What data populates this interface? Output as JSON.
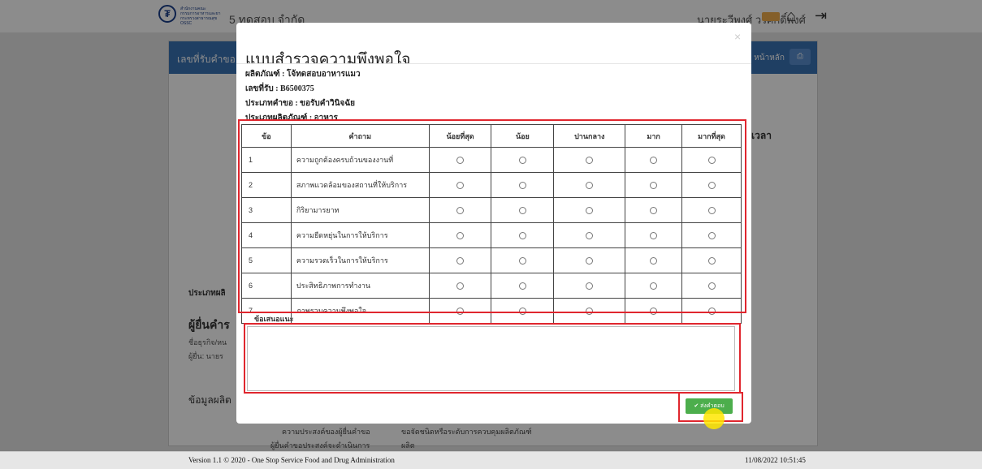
{
  "header": {
    "logo_text": "สำนักงานคณะกรรมการอาหารและยา กระทรวงสาธารณสุข OSSC",
    "title": "5 ทดสอบ จำกัด",
    "user": "นายระวีพงศ์ วรศักดิ์พงศ์"
  },
  "panel": {
    "header_left": "เลขที่รับคำขอ",
    "header_right": "หน้าหลัก",
    "time_label": "เวลา",
    "product_type_label": "ประเภทผลิ",
    "applicant_heading": "ผู้ยื่นคำร",
    "business_label": "ชื่อธุรกิจ/หน",
    "applicant_label": "ผู้ยื่น: นายร",
    "product_info_heading": "ข้อมูลผลิต",
    "purpose_label": "ความประสงค์ของผู้ยื่นคำขอ",
    "purpose_value": "ขอจัดชนิดหรือระดับการควบคุมผลิตภัณฑ์",
    "operation_label": "ผู้ยื่นคำขอประสงค์จะดำเนินการ",
    "operation_value": "ผลิต"
  },
  "modal": {
    "title": "แบบสำรวจความพึงพอใจ",
    "close": "×",
    "info": [
      "ผลิตภัณฑ์ : โจ้ทดสอบอาหารแมว",
      "เลขที่รับ : B6500375",
      "ประเภทคำขอ : ขอรับคำวินิจฉัย",
      "ประเภทผลิตภัณฑ์ : อาหาร"
    ],
    "table": {
      "headers": [
        "ข้อ",
        "คำถาม",
        "น้อยที่สุด",
        "น้อย",
        "ปานกลาง",
        "มาก",
        "มากที่สุด"
      ],
      "rows": [
        {
          "no": "1",
          "question": "ความถูกต้องครบถ้วนของงานที่"
        },
        {
          "no": "2",
          "question": "สภาพแวดล้อมของสถานที่ให้บริการ"
        },
        {
          "no": "3",
          "question": "กิริยามารยาท"
        },
        {
          "no": "4",
          "question": "ความยืดหยุ่นในการให้บริการ"
        },
        {
          "no": "5",
          "question": "ความรวดเร็วในการให้บริการ"
        },
        {
          "no": "6",
          "question": "ประสิทธิภาพการทำงาน"
        },
        {
          "no": "7",
          "question": "ภาพรวมความพึงพอใจ"
        }
      ]
    },
    "suggestion_label": "ข้อเสนอแนะ",
    "suggestion_value": "",
    "submit_label": "✔ ส่งคำตอบ"
  },
  "footer": {
    "version": "Version 1.1 © 2020 - One Stop Service Food and Drug Administration",
    "datetime": "11/08/2022 10:51:45"
  },
  "colors": {
    "highlight": "#e0262e",
    "submit": "#4cae4c",
    "panel_header": "#3a73b5"
  }
}
